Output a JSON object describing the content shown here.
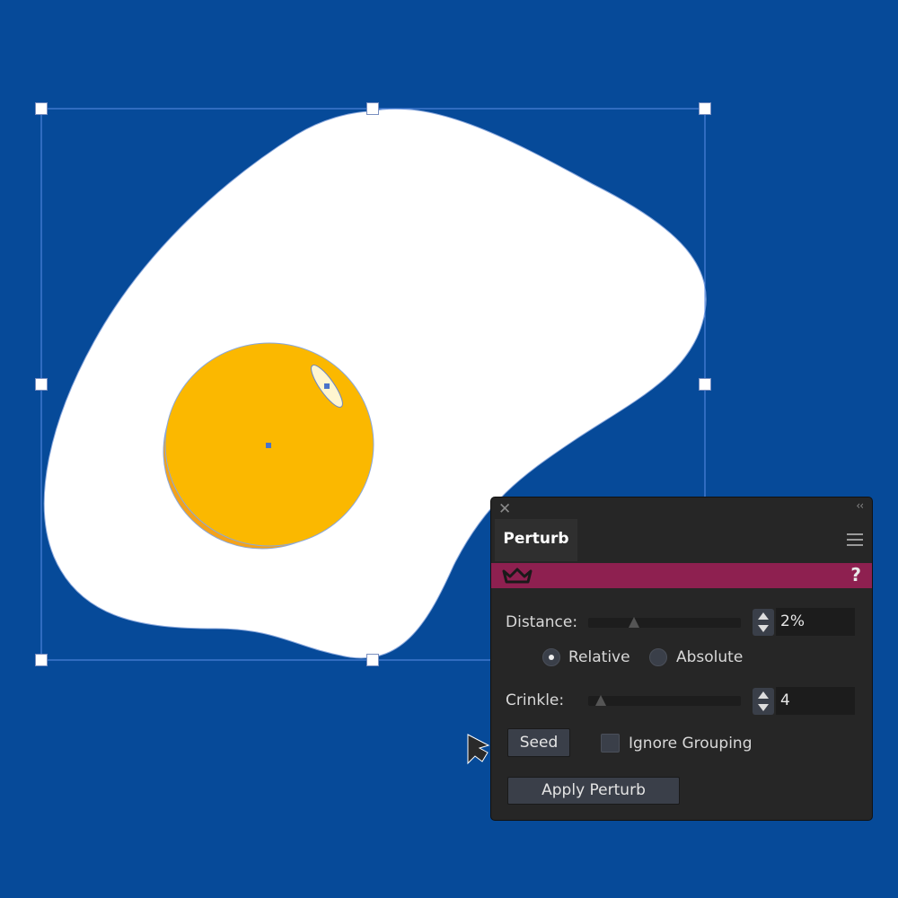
{
  "canvas": {
    "background_color": "#064a99",
    "egg_white_color": "#ffffff",
    "yolk_color": "#fbb800",
    "yolk_shadow_color": "#f4a21a",
    "selection_color": "#5b8ee6"
  },
  "panel": {
    "close_icon": "close-icon",
    "collapse_icon": "collapse-icon",
    "collapse_glyph": "‹‹",
    "tab_label": "Perturb",
    "menu_icon": "hamburger-menu-icon",
    "banner_color": "#8e2050",
    "crown_icon": "crown-icon",
    "help_label": "?",
    "distance": {
      "label": "Distance:",
      "value": "2%",
      "slider_fraction": 0.3
    },
    "mode": {
      "relative_label": "Relative",
      "absolute_label": "Absolute",
      "selected": "Relative"
    },
    "crinkle": {
      "label": "Crinkle:",
      "value": "4",
      "slider_fraction": 0.08
    },
    "seed_label": "Seed",
    "ignore_grouping_label": "Ignore Grouping",
    "ignore_grouping_checked": false,
    "apply_label": "Apply Perturb"
  }
}
